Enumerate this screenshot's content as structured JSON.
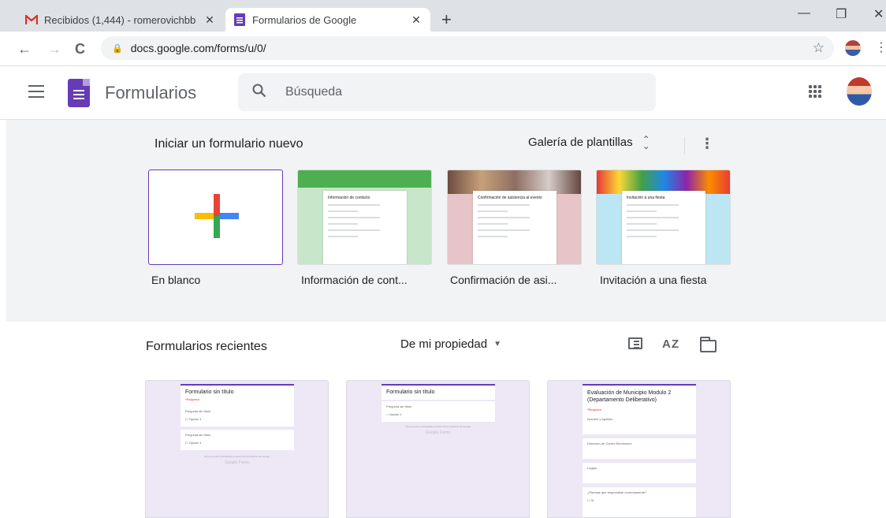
{
  "browser": {
    "tabs": [
      {
        "title": "Recibidos (1,444) - romerovichbb",
        "close": "✕",
        "active": false
      },
      {
        "title": "Formularios de Google",
        "close": "✕",
        "active": true
      }
    ],
    "new_tab": "+",
    "window_controls": {
      "minimize": "—",
      "maximize": "❐",
      "close": "✕"
    },
    "url": "docs.google.com/forms/u/0/",
    "nav": {
      "back": "←",
      "forward": "→",
      "reload": "C"
    }
  },
  "app": {
    "title": "Formularios",
    "search_placeholder": "Búsqueda",
    "brand_color": "#673ab7"
  },
  "templates": {
    "heading": "Iniciar un formulario nuevo",
    "gallery_label": "Galería de plantillas",
    "items": [
      {
        "label": "En blanco"
      },
      {
        "label": "Información de cont...",
        "preview_title": "Información de contacto",
        "color": "#c8e6c9"
      },
      {
        "label": "Confirmación de asi...",
        "preview_title": "Confirmación de asistencia al evento",
        "color": "#e6c4c8"
      },
      {
        "label": "Invitación a una fiesta",
        "preview_title": "Invitación a una fiesta",
        "color": "#bde6f4"
      }
    ]
  },
  "recent": {
    "heading": "Formularios recientes",
    "owner_filter": "De mi propiedad",
    "sort_icon_text": "AZ",
    "forms": [
      {
        "title": "Formulario sin título",
        "questions": [
          "Pregunta sin título",
          "Pregunta sin título"
        ]
      },
      {
        "title": "Formulario sin título",
        "questions": [
          "Pregunta sin título"
        ]
      },
      {
        "title": "Evaluación de Municipio Modulo 2 (Departamento Deliberativo)",
        "questions": [
          "Nombre y Apellido",
          "Dirección de Correo Electronico",
          "Legajo",
          "¿Piensas que respondiste correctamente?"
        ]
      }
    ]
  }
}
